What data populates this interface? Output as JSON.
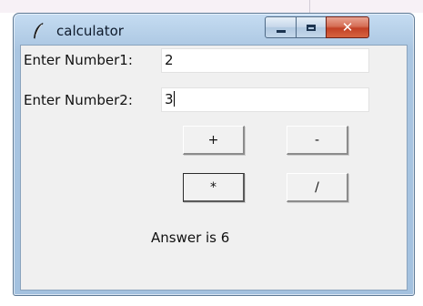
{
  "window": {
    "title": "calculator",
    "controls": {
      "minimize": "minimize",
      "maximize": "maximize",
      "close_symbol": "✕"
    },
    "icon": "feather-icon"
  },
  "form": {
    "number1": {
      "label": "Enter Number1:",
      "value": "2"
    },
    "number2": {
      "label": "Enter Number2:",
      "value": "3"
    }
  },
  "operations": {
    "add": "+",
    "subtract": "-",
    "multiply": "*",
    "divide": "/"
  },
  "result": {
    "text": "Answer is 6"
  },
  "colors": {
    "client_bg": "#f0f0f0",
    "close_button": "#c24126",
    "frame": "#a3c1df"
  }
}
